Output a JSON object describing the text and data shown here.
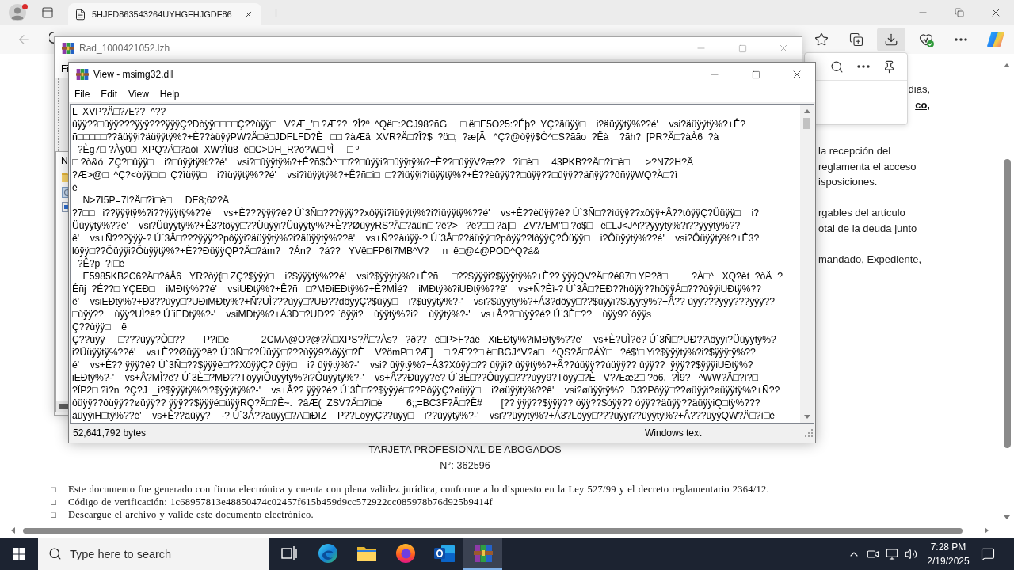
{
  "browser": {
    "tabs": [
      {
        "title": "5HJFD863543264UYHGFHJGDF86",
        "selected": true
      }
    ],
    "document": {
      "right_paragraphs": [
        [
          {
            "text": "dias,",
            "kind": "text"
          },
          {
            "text": "co,",
            "kind": "link"
          }
        ],
        [
          {
            "text": "la recepción del",
            "kind": "text"
          },
          {
            "text": "reglamenta el acceso",
            "kind": "text"
          },
          {
            "text": "isposiciones.",
            "kind": "text"
          }
        ],
        [
          {
            "text": "rgables del artículo",
            "kind": "text"
          },
          {
            "text": "otal de la deuda junto",
            "kind": "text"
          }
        ],
        [
          {
            "text": "mandado, Expediente,",
            "kind": "text"
          }
        ]
      ],
      "title": "TARJETA PROFESIONAL DE ABOGADOS",
      "number": "N°: 362596",
      "notes": [
        {
          "bullet": "□",
          "text": "Este documento fue generado con firma electrónica y cuenta con plena validez jurídica, conforme a lo dispuesto en la Ley 527/99 y el decreto reglamentario 2364/12."
        },
        {
          "bullet": "□",
          "text": "Código de verificación: 1c68957813e48850474c02457f615b459d9cc572922cc085978b76d925b9414f"
        },
        {
          "bullet": "□",
          "text": "Descargue el archivo y valide este documento electrónico."
        }
      ]
    }
  },
  "archive_window": {
    "title": "Rad_1000421052.lzh",
    "menu": [
      "Fi"
    ],
    "column_header": "N"
  },
  "viewer_window": {
    "title": "View - msimg32.dll",
    "menu": [
      "File",
      "Edit",
      "View",
      "Help"
    ],
    "lines": [
      "L  XVP?Ä□?Æ??  ^??",
      "ûÿÿ??□ûÿÿ???ÿÿÿ???ÿÿÿÇ?Dòÿÿ□□□□Ç??ùÿÿ□   V?Æ_'□ ?Æ??  ?Î?º  ^Që□:2CJ98?ñG     □ ë□E5O25:?Éþ?  YÇ?äüÿÿ□    i?äüÿÿtÿ%??é'    vsi?äüÿÿtÿ%?+Ê?",
      "ñ□□□□□??äüÿÿi?äüÿÿtÿ%?+È??àüÿÿPW?Ä□ë□JDFLFD?È   □□ ?àÆä  XVR?Ä□?Î?$  ?ö□;  ?æ[Ã   ^Ç?@òÿÿ$Ò^□S?ãão  ?Ëà_  ?ãh?  [PR?Ä□?àÀ6  ?à",
      "  ?Èg7□ ?Àÿ0□  XPQ?Ä□?äòí  XW?Ïû8  ë□C>DH_R?ò?W□ ºÌ     □ º",
      "□ ?ò&ó  ZÇ?□ûÿÿ□    i?□ûÿÿtÿ%??é'    vsi?□ûÿÿtÿ%?+Ê?ñ$Ò^□□??□ûÿÿi?□ûÿÿtÿ%?+È??□ûÿÿV?æ??   ?ì□è□     43PKB??Ä□?ì□è□      >?N72H?Ä",
      "?Æ>@□  ^Ç?<òÿÿ□i□  Ç?ìüÿÿ□    i?ìüÿÿtÿ%??é'    vsi?ìüÿÿtÿ%?+Ê?ñ□i□  □??ìüÿÿi?ìüÿÿtÿ%?+È??èüÿÿ??□ûÿÿ??□ûÿÿ??äñÿÿ??ôñÿÿWQ?Ä□?ì",
      "è",
      "    N>7I5P=7I?Ä□?ì□è□     DE8;62?Ä",
      "?7□□ _i??ÿÿÿtÿ%?i??ÿÿÿtÿ%??é'    vs+È???ÿÿÿ?ê? Ú`3Ñ□???ÿÿÿ??xôÿÿi?ìüÿÿtÿ%?i?ìüÿÿtÿ%??é'    vs+È??èüÿÿ?ê? Ú`3Ñ□??ìüÿÿ??xôÿÿ+Â??tôÿÿÇ?Üüÿÿ□    i?",
      "Üüÿÿtÿ%??é'    vsi?Üüÿÿtÿ%?+Ê3?tôÿÿ□??Üüÿÿi?Üüÿÿtÿ%?+È??ØüÿÿRS?Ä□?âün□ ?ê?>   ?ê?□□ ?â|□   ZV?ÆM\"□ ?ö$□   ë□LJ<J^i??ÿÿÿtÿ%?i??ÿÿÿtÿ%??",
      "ê'    vs+Ñ???ÿÿÿ-? Ú`3Â□???ÿÿÿ??pôÿÿi?äüÿÿtÿ%?i?äüÿÿtÿ%??ê'    vs+Ñ??àüÿÿ-? Ú`3Â□??äüÿÿ□?pôÿÿ??lôÿÿÇ?Ôüÿÿ□    i?Ôüÿÿtÿ%??é'    vsi?Ôüÿÿtÿ%?+Ê3?",
      "lôÿÿ□??Ôüÿÿi?Ôüÿÿtÿ%?+È??ÐüÿÿQP?Ä□?ám?   ?Án?   ?á??   YVë□FP6I7MB^V?     n  ë□@4@POD^Q?á&",
      "  ?Ê?p  ?ì□è",
      "    E5985KB2C6?Ä□?áÅ6   YR?òÿ{□ ZÇ?$ÿÿÿ□    i?$ÿÿÿtÿ%??é'    vsi?$ÿÿÿtÿ%?+Ê?ñ     □??$ÿÿÿi?$ÿÿÿtÿ%?+È?? ÿÿÿQV?Ä□?é87□ YP?ð□         ?À□^   XQ?èt  ?òÄ  ?",
      "Éñj  ?É??□ YÇEÐ□    iMÐtÿ%??é'    vsiUÐtÿ%?+Ê?ñ   □?MÐiEÐtÿ%?+È?MÌé?    iMÐtÿ%?iUÐtÿ%??ê'    vs+Ñ?Èì-? Ú`3Â□?EÐ??hôÿÿ??hôÿÿÁ□???ùÿÿiUÐtÿ%??",
      "ê'    vsiEÐtÿ%?+Ð3??ùÿÿ□?UÐiMÐtÿ%?+Ñ?UÌ???ùÿÿ□?UÐ??dôÿÿÇ?$ùÿÿ□    i?$ùÿÿtÿ%?-'    vsi?$ùÿÿtÿ%?+Á3?dôÿÿ□??$ùÿÿi?$ùÿÿtÿ%?+Â?? ùÿÿ???ÿÿÿ???ÿÿÿ??",
      "□ùÿÿ??    ùÿÿ?UÌ?ê? Ú`iEÐtÿ%?-'    vsiMÐtÿ%?+Á3Ð□?UÐ?? `ôÿÿi?    ùÿÿtÿ%?i?    ùÿÿtÿ%?-'    vs+Â??□ùÿÿ?é? Ú`3È□??    ùÿÿ9?`ôÿÿs",
      "Ç??ùÿÿ□    ë",
      "Ç??ùÿÿ     □???ùÿÿ?Ò□??       P?ì□è            2CMA@O?@?Ä□XPS?Ä□?Às?   ?ð??   ë□P>F?äë   XiEÐtÿ%?iMÐtÿ%??é'    vs+È?UÌ?ê? Ú`3Ñ□?UÐ??\\ôÿÿi?Üüÿÿtÿ%?",
      "i?Üüÿÿtÿ%??é'    vs+È??Øüÿÿ?ê? Ú`3Ñ□??Üüÿÿ□???ùÿÿ9?\\ôÿÿ□?È    V?ömP□ ?Æ]    □ ?Æ??□ ë□BGJ^V?a□   ^QS?Ä□?ÁÝ□   ?é$'□ Yi?$ÿÿÿtÿ%?i?$ÿÿÿtÿ%??",
      "é'    vs+È?? ÿÿÿ?ê? Ú`3Ñ□??$ÿÿÿê□??XôÿÿÇ? ûÿÿ□    i? ûÿÿtÿ%?-'    vsi? ûÿÿtÿ%?+Á3?Xôÿÿ□?? ûÿÿi? ûÿÿtÿ%?+Â??úüÿÿ??úüÿÿ?? ûÿÿ??  ÿÿÿ??$ÿÿÿiUÐtÿ%?",
      "iEÐtÿ%?-'    vs+Â?MÌ?ê? Ú`3È□?MÐ??TôÿÿiÔüÿÿtÿ%?i?Ôüÿÿtÿ%?-'    vs+Â??Ðüÿÿ?é? Ú`3È□??Ôüÿÿ□???ùÿÿ9?Tôÿÿ□?È   V?Ææ2□ ?ö6,  ?Ì9?   ^WW?Ä□?ì?□",
      "?ÏP2□ ?ì?n  ?Ç?J  _i?$ÿÿÿtÿ%?i?$ÿÿÿtÿ%?-'    vs+Â?? ÿÿÿ?é? Ú`3È□??$ÿÿÿé□??PôÿÿÇ?øüÿÿ□    i?øüÿÿtÿ%??ê'    vsi?øüÿÿtÿ%?+Ð3?Pôÿÿ□??øüÿÿi?øüÿÿtÿ%?+Ñ??",
      "ôüÿÿ??ôüÿÿ??øüÿÿ?? ÿÿÿ??$ÿÿÿé□üÿÿRQ?Ä□?Ê~.  ?âÆ(  ZSV?Ä□?ì□è         6;;=BC3F?Ä□?Ë#       [?? ÿÿÿ??$ÿÿÿ?? óÿÿ??$óÿÿ?? óÿÿ??äüÿÿ??äüÿÿiQ□tÿ%???",
      "äüÿÿiH□tÿ%??é'    vs+Ê??äüÿÿ?    -? Ú`3Á??äüÿÿ□?A□iÐIZ    P??LôÿÿÇ??üÿÿ□    i??üÿÿtÿ%?-'    vsi??üÿÿtÿ%?+Á3?Lôÿÿ□???üÿÿi??üÿÿtÿ%?+Â???üÿÿQW?Ä□?ì□è"
    ],
    "status_bar": {
      "size": "52,641,792 bytes",
      "encoding": "Windows text"
    }
  },
  "taskbar": {
    "search": {
      "placeholder": "Type here to search"
    },
    "apps": [
      {
        "kind": "edge",
        "selected": false
      },
      {
        "kind": "explorer",
        "selected": false
      },
      {
        "kind": "firefox",
        "selected": false
      },
      {
        "kind": "outlook",
        "selected": false
      },
      {
        "kind": "winrar",
        "selected": true
      }
    ],
    "time": "7:28 PM",
    "date": "2/19/2025"
  }
}
